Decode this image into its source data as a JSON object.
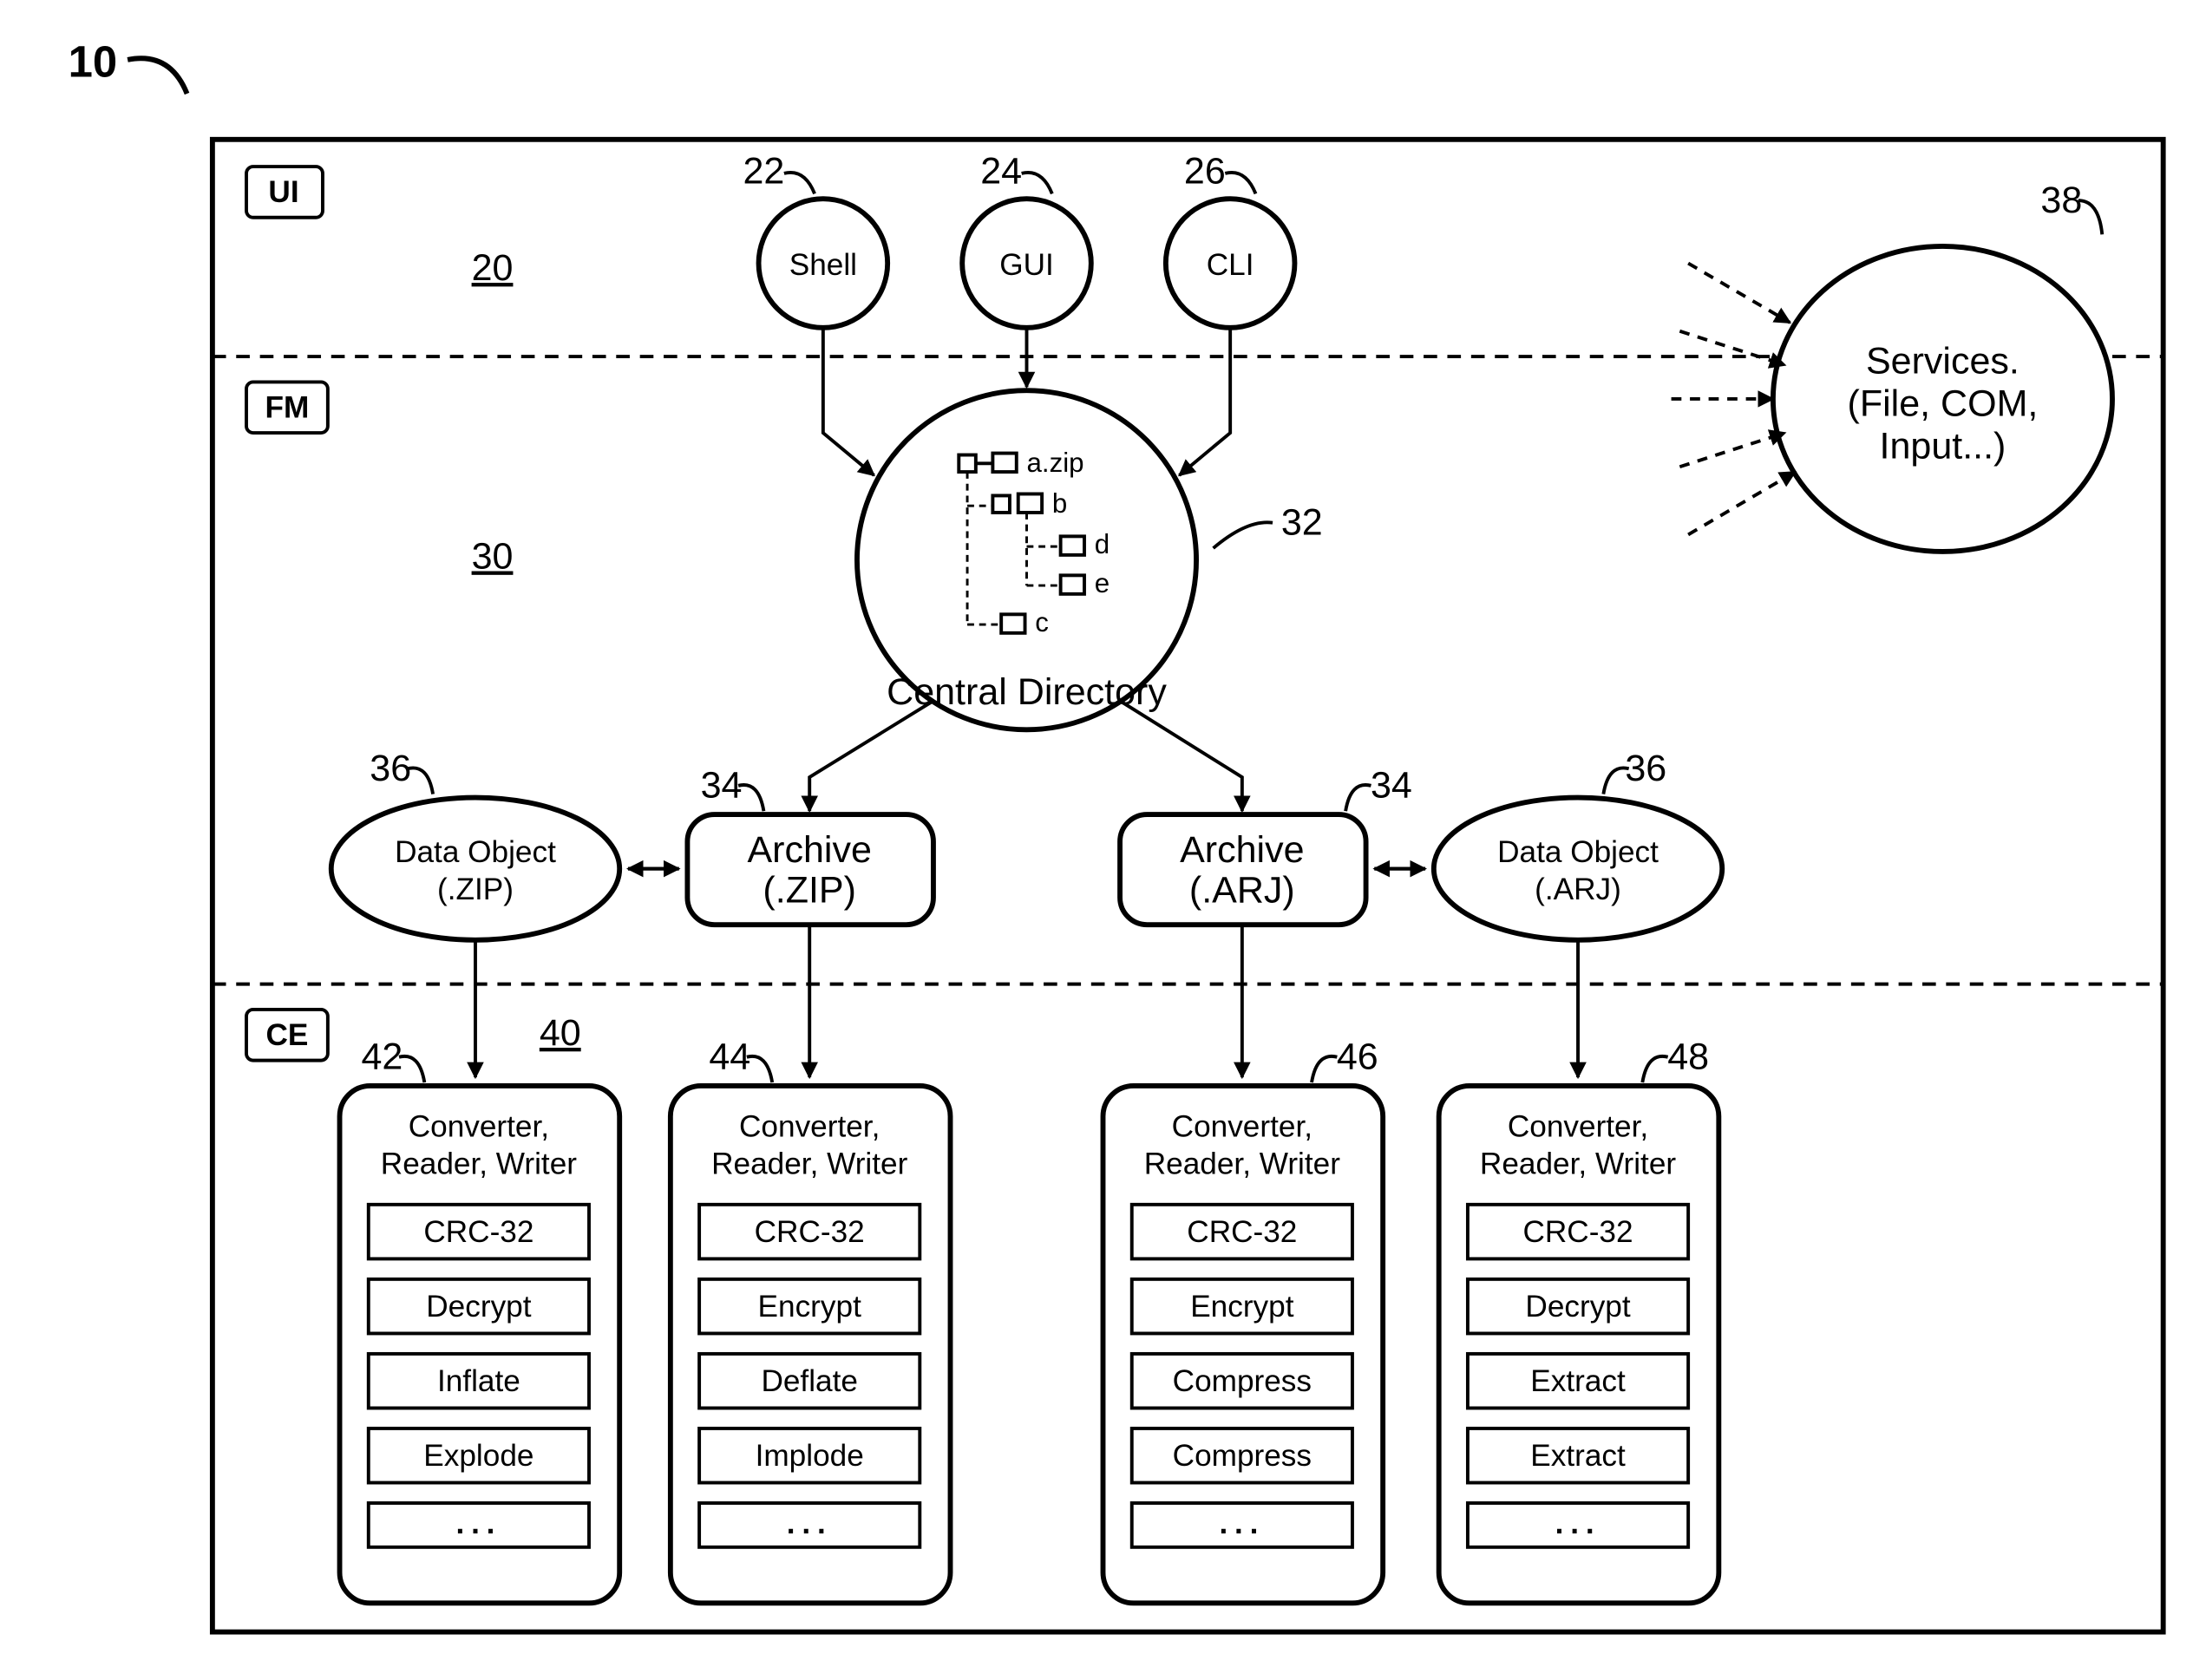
{
  "figure_ref": "10",
  "layers": {
    "ui": {
      "tag": "UI",
      "ref": "20"
    },
    "fm": {
      "tag": "FM",
      "ref": "30"
    },
    "ce": {
      "tag": "CE",
      "ref": "40"
    }
  },
  "ui_nodes": {
    "shell": {
      "label": "Shell",
      "ref": "22"
    },
    "gui": {
      "label": "GUI",
      "ref": "24"
    },
    "cli": {
      "label": "CLI",
      "ref": "26"
    }
  },
  "services": {
    "ref": "38",
    "line1": "Services.",
    "line2": "(File, COM,",
    "line3": "Input...)"
  },
  "central_dir": {
    "ref": "32",
    "title": "Central Directory",
    "tree": {
      "a": "a.zip",
      "b": "b",
      "c": "c",
      "d": "d",
      "e": "e"
    }
  },
  "archives": {
    "zip": {
      "label1": "Archive",
      "label2": "(.ZIP)",
      "ref": "34"
    },
    "arj": {
      "label1": "Archive",
      "label2": "(.ARJ)",
      "ref": "34"
    }
  },
  "data_objects": {
    "zip": {
      "label1": "Data Object",
      "label2": "(.ZIP)",
      "ref": "36"
    },
    "arj": {
      "label1": "Data Object",
      "label2": "(.ARJ)",
      "ref": "36"
    }
  },
  "converters": {
    "c42": {
      "ref": "42",
      "title": "Converter,\nReader, Writer",
      "ops": [
        "CRC-32",
        "Decrypt",
        "Inflate",
        "Explode",
        "..."
      ]
    },
    "c44": {
      "ref": "44",
      "title": "Converter,\nReader, Writer",
      "ops": [
        "CRC-32",
        "Encrypt",
        "Deflate",
        "Implode",
        "..."
      ]
    },
    "c46": {
      "ref": "46",
      "title": "Converter,\nReader, Writer",
      "ops": [
        "CRC-32",
        "Encrypt",
        "Compress",
        "Compress",
        "..."
      ]
    },
    "c48": {
      "ref": "48",
      "title": "Converter,\nReader, Writer",
      "ops": [
        "CRC-32",
        "Decrypt",
        "Extract",
        "Extract",
        "..."
      ]
    }
  }
}
